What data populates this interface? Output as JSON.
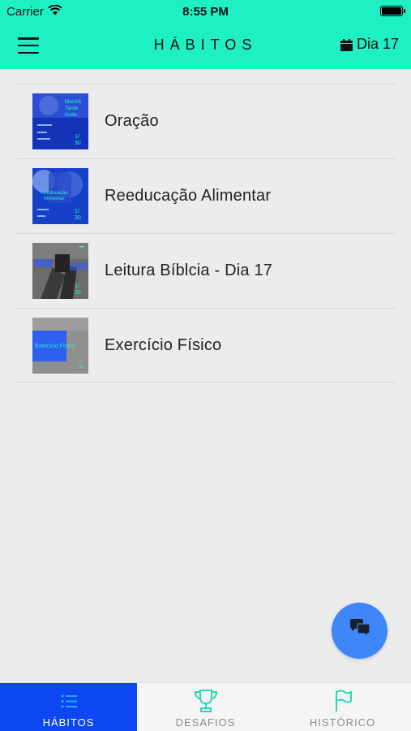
{
  "status_bar": {
    "carrier": "Carrier",
    "time": "8:55 PM"
  },
  "nav": {
    "title": "HÁBITOS",
    "day_label": "Dia 17"
  },
  "habits": [
    {
      "label": "Oração",
      "thumb_text": "Manhã Tarde Noite",
      "thumb_icon": "prayer-thumbnail"
    },
    {
      "label": "Reeducação Alimentar",
      "thumb_text": "Reeducação Alimentar",
      "thumb_icon": "nutrition-thumbnail"
    },
    {
      "label": "Leitura Bíblcia - Dia 17",
      "thumb_text": "",
      "thumb_icon": "bible-reading-thumbnail"
    },
    {
      "label": "Exercício Físico",
      "thumb_text": "Exercício Físico",
      "thumb_icon": "exercise-thumbnail"
    }
  ],
  "fab": {
    "icon": "chat-bubbles-icon"
  },
  "tabs": [
    {
      "label": "HÁBITOS",
      "icon": "list-icon",
      "active": true
    },
    {
      "label": "DESAFIOS",
      "icon": "trophy-icon",
      "active": false
    },
    {
      "label": "HISTÓRICO",
      "icon": "flag-icon",
      "active": false
    }
  ],
  "colors": {
    "header_bg": "#1ef0c4",
    "accent": "#1ef0c4",
    "active_tab": "#0d47f2",
    "fab": "#3f86f8",
    "background": "#ececec"
  }
}
